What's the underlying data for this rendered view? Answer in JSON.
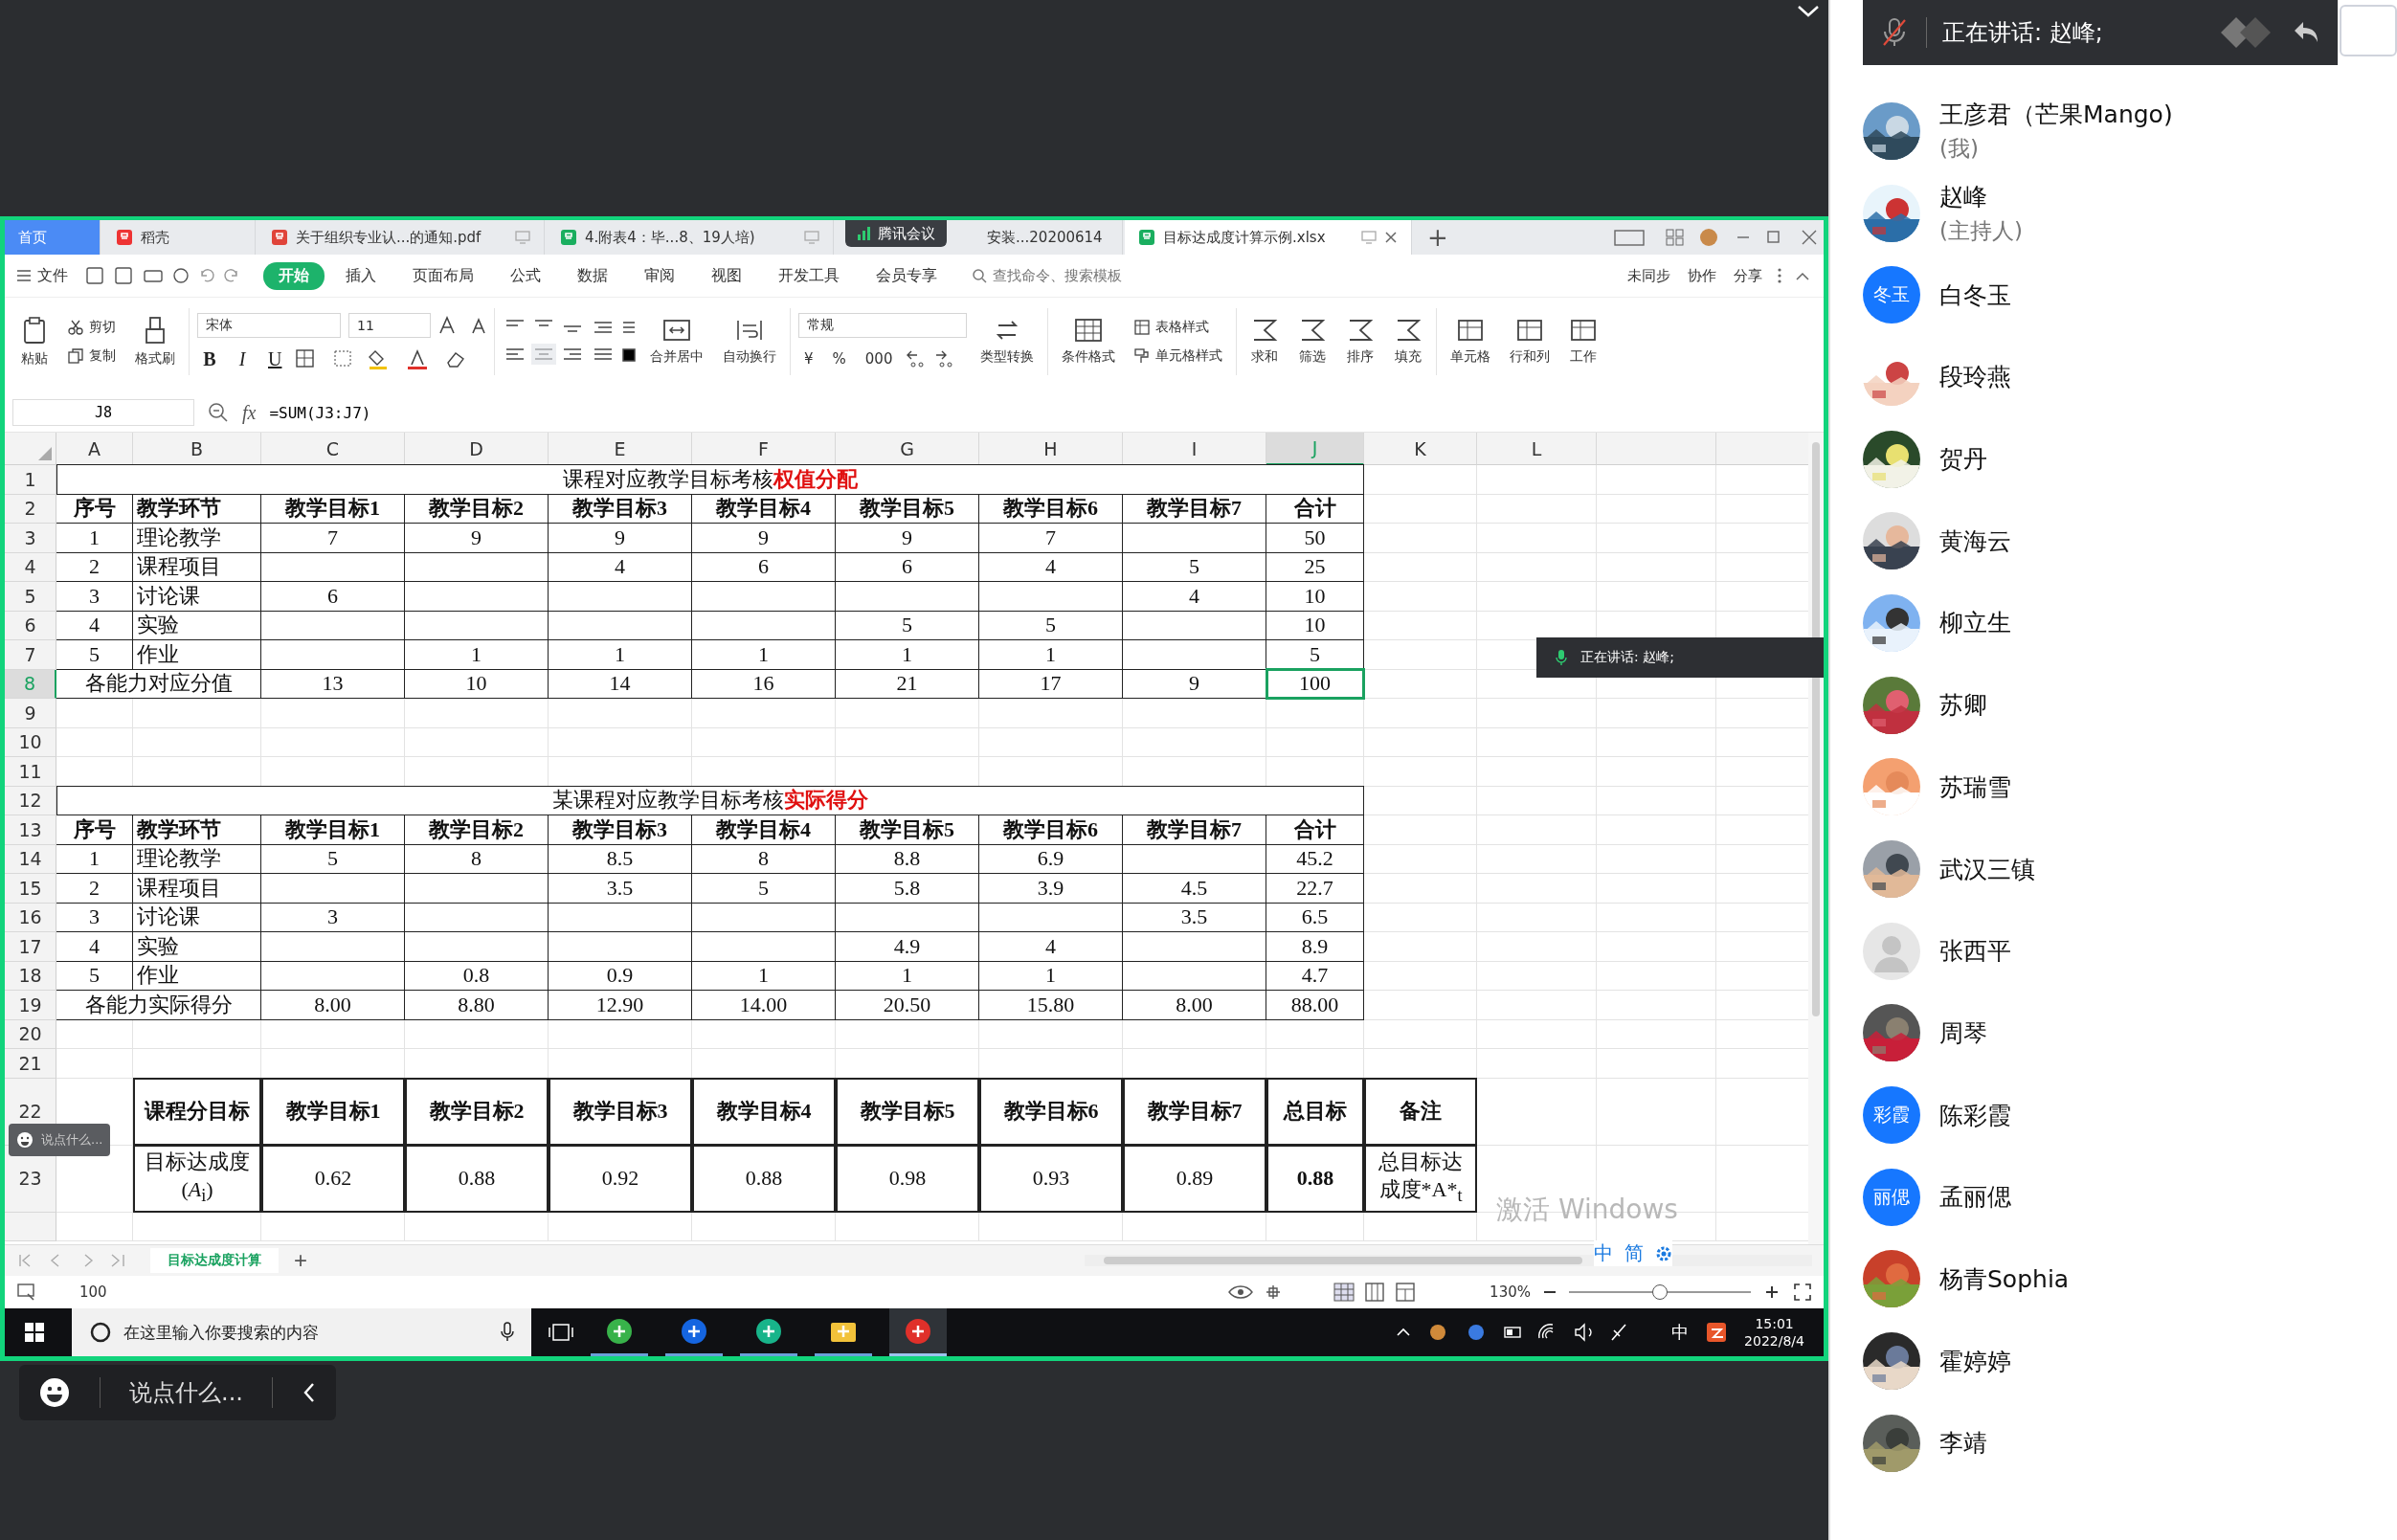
{
  "wps": {
    "tabs": [
      {
        "label": "首页",
        "kind": "home",
        "selected": false
      },
      {
        "label": "稻壳",
        "kind": "docer",
        "selected": false
      },
      {
        "label": "关于组织专业认...的通知.pdf",
        "kind": "pdf",
        "selected": false
      },
      {
        "label": "4.附表4：毕...8、19人培)",
        "kind": "sheet",
        "selected": false
      },
      {
        "label": "安装...20200614",
        "kind": "sheet",
        "selected": false
      },
      {
        "label": "目标达成度计算示例.xlsx",
        "kind": "sheet",
        "selected": true
      }
    ],
    "add_tab": "+",
    "meeting_tag": "腾讯会议",
    "menu": {
      "file": "文件",
      "items": [
        {
          "label": "开始",
          "selected": true
        },
        {
          "label": "插入",
          "selected": false
        },
        {
          "label": "页面布局",
          "selected": false
        },
        {
          "label": "公式",
          "selected": false
        },
        {
          "label": "数据",
          "selected": false
        },
        {
          "label": "审阅",
          "selected": false
        },
        {
          "label": "视图",
          "selected": false
        },
        {
          "label": "开发工具",
          "selected": false
        },
        {
          "label": "会员专享",
          "selected": false
        }
      ],
      "search": "查找命令、搜索模板",
      "actions": [
        "未同步",
        "协作",
        "分享"
      ]
    },
    "ribbon": {
      "paste": "粘贴",
      "cut": "剪切",
      "copy": "复制",
      "format_painter": "格式刷",
      "font": "宋体",
      "font_size": "11",
      "style_letters": [
        "B",
        "I",
        "U"
      ],
      "merge": "合并居中",
      "wrap": "自动换行",
      "number_format": "常规",
      "number_symbols": [
        "¥",
        "%",
        "000"
      ],
      "convert": "类型转换",
      "conditional": "条件格式",
      "table_style": "表格样式",
      "cell_style": "单元格样式",
      "tools": [
        "求和",
        "筛选",
        "排序",
        "填充"
      ],
      "cell_tools": [
        "单元格",
        "行和列",
        "工作"
      ]
    },
    "formula_bar": {
      "name_box": "J8",
      "fx": "fx",
      "formula": "=SUM(J3:J7)"
    },
    "sheet": {
      "columns": [
        {
          "label": "A",
          "selected": false
        },
        {
          "label": "B",
          "selected": false
        },
        {
          "label": "C",
          "selected": false
        },
        {
          "label": "D",
          "selected": false
        },
        {
          "label": "E",
          "selected": false
        },
        {
          "label": "F",
          "selected": false
        },
        {
          "label": "G",
          "selected": false
        },
        {
          "label": "H",
          "selected": false
        },
        {
          "label": "I",
          "selected": false
        },
        {
          "label": "J",
          "selected": true
        },
        {
          "label": "K",
          "selected": false
        },
        {
          "label": "L",
          "selected": false
        }
      ],
      "rows": [
        {
          "number": "1",
          "selected": false,
          "kind": "title",
          "title": "课程对应教学目标考核**权值分配**"
        },
        {
          "number": "2",
          "selected": false,
          "kind": "header",
          "cells": [
            "序号",
            "教学环节",
            "教学目标1",
            "教学目标2",
            "教学目标3",
            "教学目标4",
            "教学目标5",
            "教学目标6",
            "教学目标7",
            "合计"
          ]
        },
        {
          "number": "3",
          "selected": false,
          "kind": "data",
          "cells": [
            "1",
            "理论教学",
            "7",
            "9",
            "9",
            "9",
            "9",
            "7",
            null,
            "50"
          ]
        },
        {
          "number": "4",
          "selected": false,
          "kind": "data",
          "cells": [
            "2",
            "课程项目",
            null,
            null,
            "4",
            "6",
            "6",
            "4",
            "5",
            "25"
          ]
        },
        {
          "number": "5",
          "selected": false,
          "kind": "data",
          "cells": [
            "3",
            "讨论课",
            "6",
            null,
            null,
            null,
            null,
            null,
            "4",
            "10"
          ]
        },
        {
          "number": "6",
          "selected": false,
          "kind": "data",
          "cells": [
            "4",
            "实验",
            null,
            null,
            null,
            null,
            "5",
            "5",
            null,
            "10"
          ]
        },
        {
          "number": "7",
          "selected": false,
          "kind": "data",
          "cells": [
            "5",
            "作业",
            null,
            "1",
            "1",
            "1",
            "1",
            "1",
            null,
            "5"
          ]
        },
        {
          "number": "8",
          "selected": true,
          "kind": "total",
          "label": "各能力对应分值",
          "cells": [
            "13",
            "10",
            "14",
            "16",
            "21",
            "17",
            "9",
            "100"
          ]
        },
        {
          "number": "9",
          "selected": false,
          "kind": "blank"
        },
        {
          "number": "10",
          "selected": false,
          "kind": "blank"
        },
        {
          "number": "11",
          "selected": false,
          "kind": "blank"
        },
        {
          "number": "12",
          "selected": false,
          "kind": "title",
          "title": "某课程对应教学目标考核**实际得分**"
        },
        {
          "number": "13",
          "selected": false,
          "kind": "header",
          "cells": [
            "序号",
            "教学环节",
            "教学目标1",
            "教学目标2",
            "教学目标3",
            "教学目标4",
            "教学目标5",
            "教学目标6",
            "教学目标7",
            "合计"
          ]
        },
        {
          "number": "14",
          "selected": false,
          "kind": "data",
          "cells": [
            "1",
            "理论教学",
            "5",
            "8",
            "8.5",
            "8",
            "8.8",
            "6.9",
            null,
            "45.2"
          ]
        },
        {
          "number": "15",
          "selected": false,
          "kind": "data",
          "cells": [
            "2",
            "课程项目",
            null,
            null,
            "3.5",
            "5",
            "5.8",
            "3.9",
            "4.5",
            "22.7"
          ]
        },
        {
          "number": "16",
          "selected": false,
          "kind": "data",
          "cells": [
            "3",
            "讨论课",
            "3",
            null,
            null,
            null,
            null,
            null,
            "3.5",
            "6.5"
          ]
        },
        {
          "number": "17",
          "selected": false,
          "kind": "data",
          "cells": [
            "4",
            "实验",
            null,
            null,
            null,
            null,
            "4.9",
            "4",
            null,
            "8.9"
          ]
        },
        {
          "number": "18",
          "selected": false,
          "kind": "data",
          "cells": [
            "5",
            "作业",
            null,
            "0.8",
            "0.9",
            "1",
            "1",
            "1",
            null,
            "4.7"
          ]
        },
        {
          "number": "19",
          "selected": false,
          "kind": "total",
          "label": "各能力实际得分",
          "cells": [
            "8.00",
            "8.80",
            "12.90",
            "14.00",
            "20.50",
            "15.80",
            "8.00",
            "88.00"
          ]
        },
        {
          "number": "20",
          "selected": false,
          "kind": "blank"
        },
        {
          "number": "21",
          "selected": false,
          "kind": "blank"
        },
        {
          "number": "22",
          "selected": false,
          "kind": "summary",
          "cells": [
            {
              "text": "课程分目标",
              "bold": true
            },
            {
              "text": "教学目标1",
              "bold": true
            },
            {
              "text": "教学目标2",
              "bold": true
            },
            {
              "text": "教学目标3",
              "bold": true
            },
            {
              "text": "教学目标4",
              "bold": true
            },
            {
              "text": "教学目标5",
              "bold": true
            },
            {
              "text": "教学目标6",
              "bold": true
            },
            {
              "text": "教学目标7",
              "bold": true
            },
            {
              "text": "总目标",
              "bold": true
            },
            {
              "text": "备注",
              "bold": true
            }
          ]
        },
        {
          "number": "23",
          "selected": false,
          "kind": "summary",
          "cells": [
            {
              "text": "目标达成度(*A*$_{i}$)",
              "bold": false
            },
            {
              "text": "0.62",
              "bold": false
            },
            {
              "text": "0.88",
              "bold": false
            },
            {
              "text": "0.92",
              "bold": false
            },
            {
              "text": "0.88",
              "bold": false
            },
            {
              "text": "0.98",
              "bold": false
            },
            {
              "text": "0.93",
              "bold": false
            },
            {
              "text": "0.89",
              "bold": false
            },
            {
              "text": "0.88",
              "bold": true
            },
            {
              "text": "总目标达成度*A*$_{t}$",
              "bold": false
            }
          ]
        }
      ],
      "sheet_tab": {
        "label": "目标达成度计算",
        "selected": true
      },
      "add_sheet": "+"
    },
    "status_bar": {
      "value": "100",
      "zoom": "130%",
      "zoom_level": {
        "level": 0.5
      }
    },
    "activation_notice": "激活 Windows",
    "ime_bar": [
      "中",
      "简"
    ],
    "taskbar": {
      "search_placeholder": "在这里输入你要搜索的内容",
      "apps": [
        {
          "kind": "browser",
          "selected": false
        },
        {
          "kind": "meeting",
          "selected": false
        },
        {
          "kind": "notes",
          "selected": false
        },
        {
          "kind": "folder",
          "selected": false
        },
        {
          "kind": "wps",
          "selected": true
        }
      ],
      "input_mode": "中",
      "time": "15:01",
      "date": "2022/8/4"
    }
  },
  "shared_overlays": {
    "speaking": "正在讲话: 赵峰;",
    "chat_hint": "说点什么..."
  },
  "chat_bar": {
    "placeholder": "说点什么..."
  },
  "speaker_bar": {
    "text": "正在讲话: 赵峰;"
  },
  "participants": [
    {
      "name": "王彦君（芒果Mango)",
      "role": "(我)"
    },
    {
      "name": "赵峰",
      "role": "(主持人)"
    },
    {
      "name": "白冬玉",
      "kind": "initials",
      "initials": "冬玉"
    },
    {
      "name": "段玲燕"
    },
    {
      "name": "贺丹"
    },
    {
      "name": "黄海云"
    },
    {
      "name": "柳立生"
    },
    {
      "name": "苏卿"
    },
    {
      "name": "苏瑞雪"
    },
    {
      "name": "武汉三镇"
    },
    {
      "name": "张西平",
      "kind": "default"
    },
    {
      "name": "周琴"
    },
    {
      "name": "陈彩霞",
      "kind": "initials",
      "initials": "彩霞"
    },
    {
      "name": "孟丽偲",
      "kind": "initials",
      "initials": "丽偲"
    },
    {
      "name": "杨青Sophia"
    },
    {
      "name": "霍婷婷"
    },
    {
      "name": "李靖"
    }
  ]
}
